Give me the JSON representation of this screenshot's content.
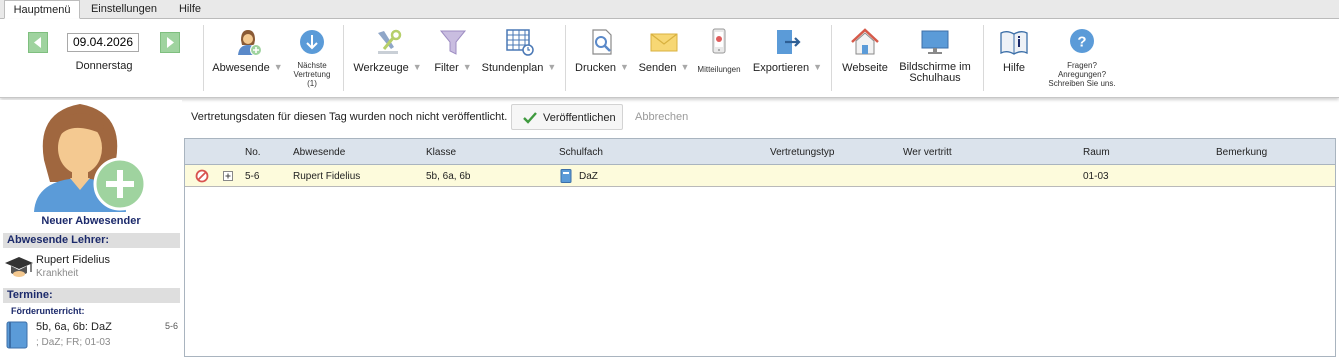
{
  "menu": {
    "tabs": [
      {
        "label": "Hauptmenü",
        "active": true
      },
      {
        "label": "Einstellungen",
        "active": false
      },
      {
        "label": "Hilfe",
        "active": false
      }
    ]
  },
  "date": {
    "value": "09.04.2026",
    "weekday": "Donnerstag"
  },
  "ribbon": {
    "absent_label": "Abwesende",
    "next_sub_line1": "Nächste",
    "next_sub_line2": "Vertretung",
    "next_sub_line3": "(1)",
    "tools_label": "Werkzeuge",
    "filter_label": "Filter",
    "timetable_label": "Stundenplan",
    "print_label": "Drucken",
    "send_label": "Senden",
    "messages_label": "Mitteilungen",
    "export_label": "Exportieren",
    "website_label": "Webseite",
    "screens_line1": "Bildschirme im",
    "screens_line2": "Schulhaus",
    "help_label": "Hilfe",
    "questions_line1": "Fragen?",
    "questions_line2": "Anregungen?",
    "questions_line3": "Schreiben Sie uns."
  },
  "left": {
    "new_absent_label": "Neuer Abwesender",
    "absent_teachers_title": "Abwesende Lehrer:",
    "teacher_name": "Rupert Fidelius",
    "teacher_reason": "Krankheit",
    "appointments_title": "Termine:",
    "appointment_category": "Förderunterricht:",
    "appointment_title": "5b, 6a, 6b: DaZ",
    "appointment_period": "5-6",
    "appointment_detail": "; DaZ; FR; 01-03"
  },
  "content": {
    "notice": "Vertretungsdaten für diesen Tag wurden noch nicht veröffentlicht.",
    "publish_label": "Veröffentlichen",
    "cancel_label": "Abbrechen"
  },
  "table": {
    "columns": [
      "No.",
      "Abwesende",
      "Klasse",
      "Schulfach",
      "Vertretungstyp",
      "Wer vertritt",
      "Raum",
      "Bemerkung"
    ],
    "rows": [
      {
        "no": "5-6",
        "absent": "Rupert Fidelius",
        "class": "5b, 6a, 6b",
        "subject": "DaZ",
        "sub_type": "",
        "substitute": "",
        "room": "01-03",
        "remark": ""
      }
    ]
  },
  "colors": {
    "accent_green": "#9fd39f",
    "header_blue": "#dbe3ec",
    "row_highlight": "#fdfbdc",
    "section_text": "#1c2a6b"
  }
}
